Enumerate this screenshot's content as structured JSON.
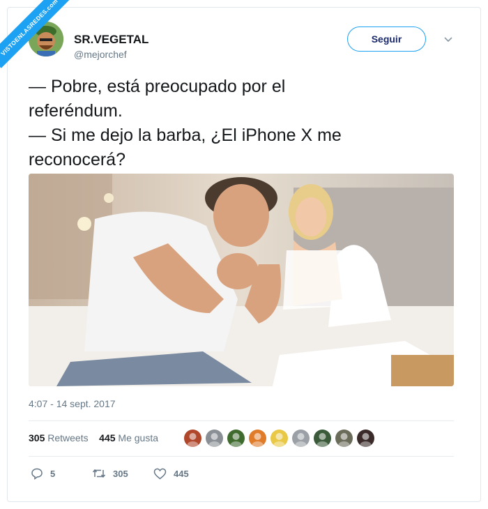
{
  "watermark": "VISTOENLASREDES.com",
  "user": {
    "name": "SR.VEGETAL",
    "handle": "@mejorchef",
    "avatar_icon": "avatar-vegetable-chef"
  },
  "follow_label": "Seguir",
  "tweet": {
    "lines": [
      "— Pobre, está preocupado por el",
      "referéndum.",
      "— Si me dejo la barba, ¿El iPhone X me",
      "reconocerá?"
    ],
    "timestamp": "4:07 - 14 sept. 2017"
  },
  "stats": {
    "retweets_count": "305",
    "retweets_label": "Retweets",
    "likes_count": "445",
    "likes_label": "Me gusta"
  },
  "liker_avatars": [
    "#b0462a",
    "#8a8f95",
    "#3f6b2f",
    "#e07b2a",
    "#e8c845",
    "#9aa0a5",
    "#3a5a3a",
    "#6b6b5a",
    "#3a2a2a"
  ],
  "actions": {
    "replies": "5",
    "retweets": "305",
    "likes": "445"
  },
  "colors": {
    "accent": "#1da1f2",
    "text": "#14171a",
    "muted": "#657786"
  }
}
